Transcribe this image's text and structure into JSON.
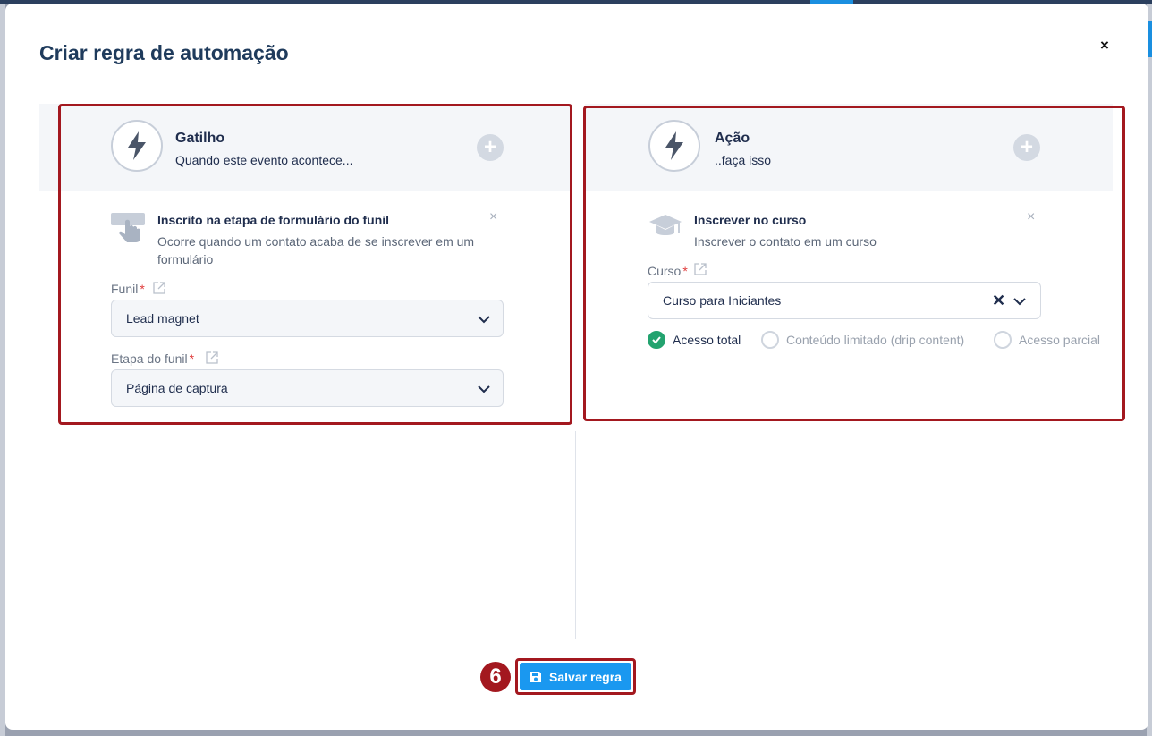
{
  "modal": {
    "title": "Criar regra de automação",
    "close_label": "×"
  },
  "trigger": {
    "header_title": "Gatilho",
    "header_subtitle": "Quando este evento acontece...",
    "add_label": "+",
    "item_title": "Inscrito na etapa de formulário do funil",
    "item_description": "Ocorre quando um contato acaba de se inscrever em um formulário",
    "remove_label": "×",
    "funnel_label": "Funil",
    "funnel_value": "Lead magnet",
    "stage_label": "Etapa do funil",
    "stage_value": "Página de captura",
    "required_mark": "*"
  },
  "action": {
    "header_title": "Ação",
    "header_subtitle": "..faça isso",
    "add_label": "+",
    "item_title": "Inscrever no curso",
    "item_description": "Inscrever o contato em um curso",
    "remove_label": "×",
    "course_label": "Curso",
    "course_value": "Curso para Iniciantes",
    "clear_label": "✕",
    "required_mark": "*",
    "access_options": [
      {
        "label": "Acesso total",
        "selected": true
      },
      {
        "label": "Conteúdo limitado (drip content)",
        "selected": false
      },
      {
        "label": "Acesso parcial",
        "selected": false
      }
    ]
  },
  "footer": {
    "save_label": "Salvar regra",
    "step_number": "6"
  },
  "colors": {
    "accent": "#1a98f0",
    "highlight": "#a3181f",
    "success": "#23a36f"
  }
}
